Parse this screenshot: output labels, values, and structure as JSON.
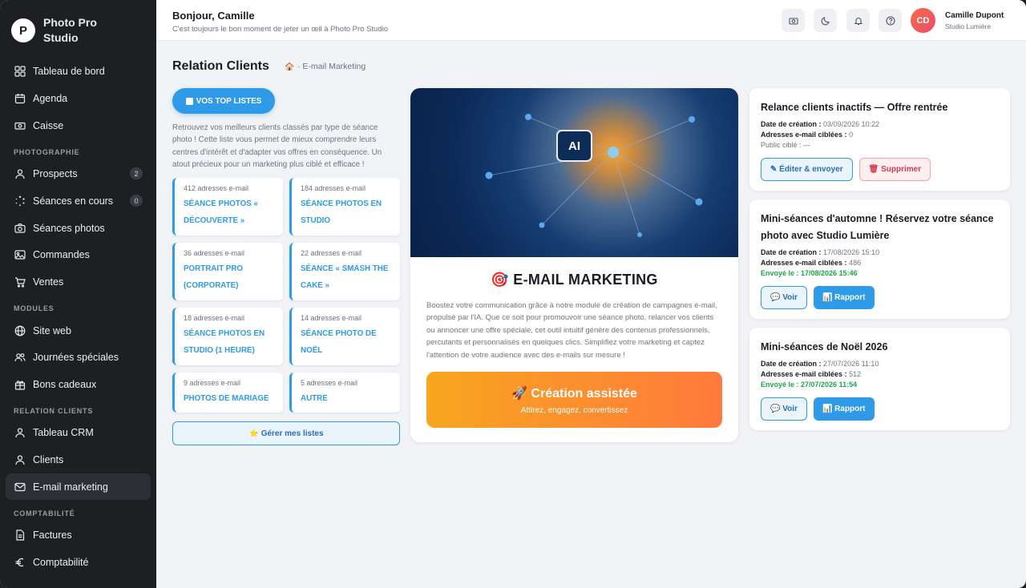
{
  "brand": {
    "logo_letter": "P",
    "name": "Photo Pro Studio"
  },
  "sidebar": {
    "items": [
      {
        "label": "Tableau de bord",
        "icon": "dashboard-icon"
      },
      {
        "label": "Agenda",
        "icon": "calendar-icon"
      },
      {
        "label": "Caisse",
        "icon": "cash-register-icon"
      },
      {
        "label": "Prospects",
        "icon": "user-icon",
        "badge": "2"
      },
      {
        "label": "Séances en cours",
        "icon": "loader-icon",
        "badge": "0"
      },
      {
        "label": "Séances photos",
        "icon": "camera-icon"
      },
      {
        "label": "Commandes",
        "icon": "image-icon"
      },
      {
        "label": "Ventes",
        "icon": "cart-icon"
      },
      {
        "label": "Site web",
        "icon": "globe-icon"
      },
      {
        "label": "Journées spéciales",
        "icon": "users-icon"
      },
      {
        "label": "Bons cadeaux",
        "icon": "gift-icon"
      },
      {
        "label": "Tableau CRM",
        "icon": "user-icon"
      },
      {
        "label": "Clients",
        "icon": "user-icon"
      },
      {
        "label": "E-mail marketing",
        "icon": "mail-icon",
        "active": true
      },
      {
        "label": "Factures",
        "icon": "document-icon"
      },
      {
        "label": "Comptabilité",
        "icon": "euro-icon"
      }
    ],
    "sections": [
      "PHOTOGRAPHIE",
      "MODULES",
      "RELATION CLIENTS",
      "COMPTABILITÉ"
    ]
  },
  "topbar": {
    "greeting": "Bonjour, Camille",
    "subtitle": "C'est toujours le bon moment de jeter un œil à Photo Pro Studio",
    "user_initials": "CD",
    "user_name": "Camille Dupont",
    "user_studio": "Studio Lumière"
  },
  "page": {
    "title": "Relation Clients",
    "breadcrumb": "· E-mail Marketing"
  },
  "lists": {
    "button_label": "VOS TOP LISTES",
    "description": "Retrouvez vos meilleurs clients classés par type de séance photo ! Cette liste vous permet de mieux comprendre leurs centres d'intérêt et d'adapter vos offres en conséquence. Un atout précieux pour un marketing plus ciblé et efficace !",
    "items": [
      {
        "count": "412 adresses e-mail",
        "name": "Séance photos « découverte »"
      },
      {
        "count": "184 adresses e-mail",
        "name": "Séance photos en studio"
      },
      {
        "count": "36 adresses e-mail",
        "name": "Portrait pro (corporate)"
      },
      {
        "count": "22 adresses e-mail",
        "name": "Séance « smash the cake »"
      },
      {
        "count": "18 adresses e-mail",
        "name": "Séance photos en studio (1 heure)"
      },
      {
        "count": "14 adresses e-mail",
        "name": "Séance photo de Noël"
      },
      {
        "count": "9 adresses e-mail",
        "name": "Photos de mariage"
      },
      {
        "count": "5 adresses e-mail",
        "name": "Autre"
      }
    ],
    "manage_label": "⭐ Gérer mes listes"
  },
  "email_marketing": {
    "badge": "AI",
    "title": "🎯 E-MAIL MARKETING",
    "description": "Boostez votre communication grâce à notre module de création de campagnes e-mail, propulsé par l'IA. Que ce soit pour promouvoir une séance photo, relancer vos clients ou annoncer une offre spéciale, cet outil intuitif génère des contenus professionnels, percutants et personnalisés en quelques clics. Simplifiez votre marketing et captez l'attention de votre audience avec des e-mails sur mesure !",
    "cta_title": "🚀 Création assistée",
    "cta_subtitle": "Attirez, engagez, convertissez"
  },
  "campaigns": [
    {
      "title": "Relance clients inactifs — Offre rentrée",
      "created_label": "Date de création :",
      "created": "03/09/2026 10:22",
      "targets_label": "Adresses e-mail ciblées :",
      "targets": "0",
      "extra": "Public ciblé : —",
      "actions": [
        "✎ Éditer & envoyer",
        "🗑 Supprimer"
      ]
    },
    {
      "title": "Mini-séances d'automne ! Réservez votre séance photo avec Studio Lumière",
      "created_label": "Date de création :",
      "created": "17/08/2026 15:10",
      "targets_label": "Adresses e-mail ciblées :",
      "targets": "486",
      "extra": "Envoyé le : 17/08/2026 15:46",
      "actions": [
        "💬 Voir",
        "📊 Rapport"
      ]
    },
    {
      "title": "Mini-séances de Noël 2026",
      "created_label": "Date de création :",
      "created": "27/07/2026 11:10",
      "targets_label": "Adresses e-mail ciblées :",
      "targets": "512",
      "extra": "Envoyé le : 27/07/2026 11:54",
      "actions": [
        "💬 Voir",
        "📊 Rapport"
      ]
    }
  ],
  "colors": {
    "accent": "#2f9ae8",
    "sidebar": "#1e1f23",
    "sent": "#1ea64a",
    "danger": "#d63a4f",
    "cta_start": "#f7a61f",
    "cta_end": "#ff7a3c"
  }
}
